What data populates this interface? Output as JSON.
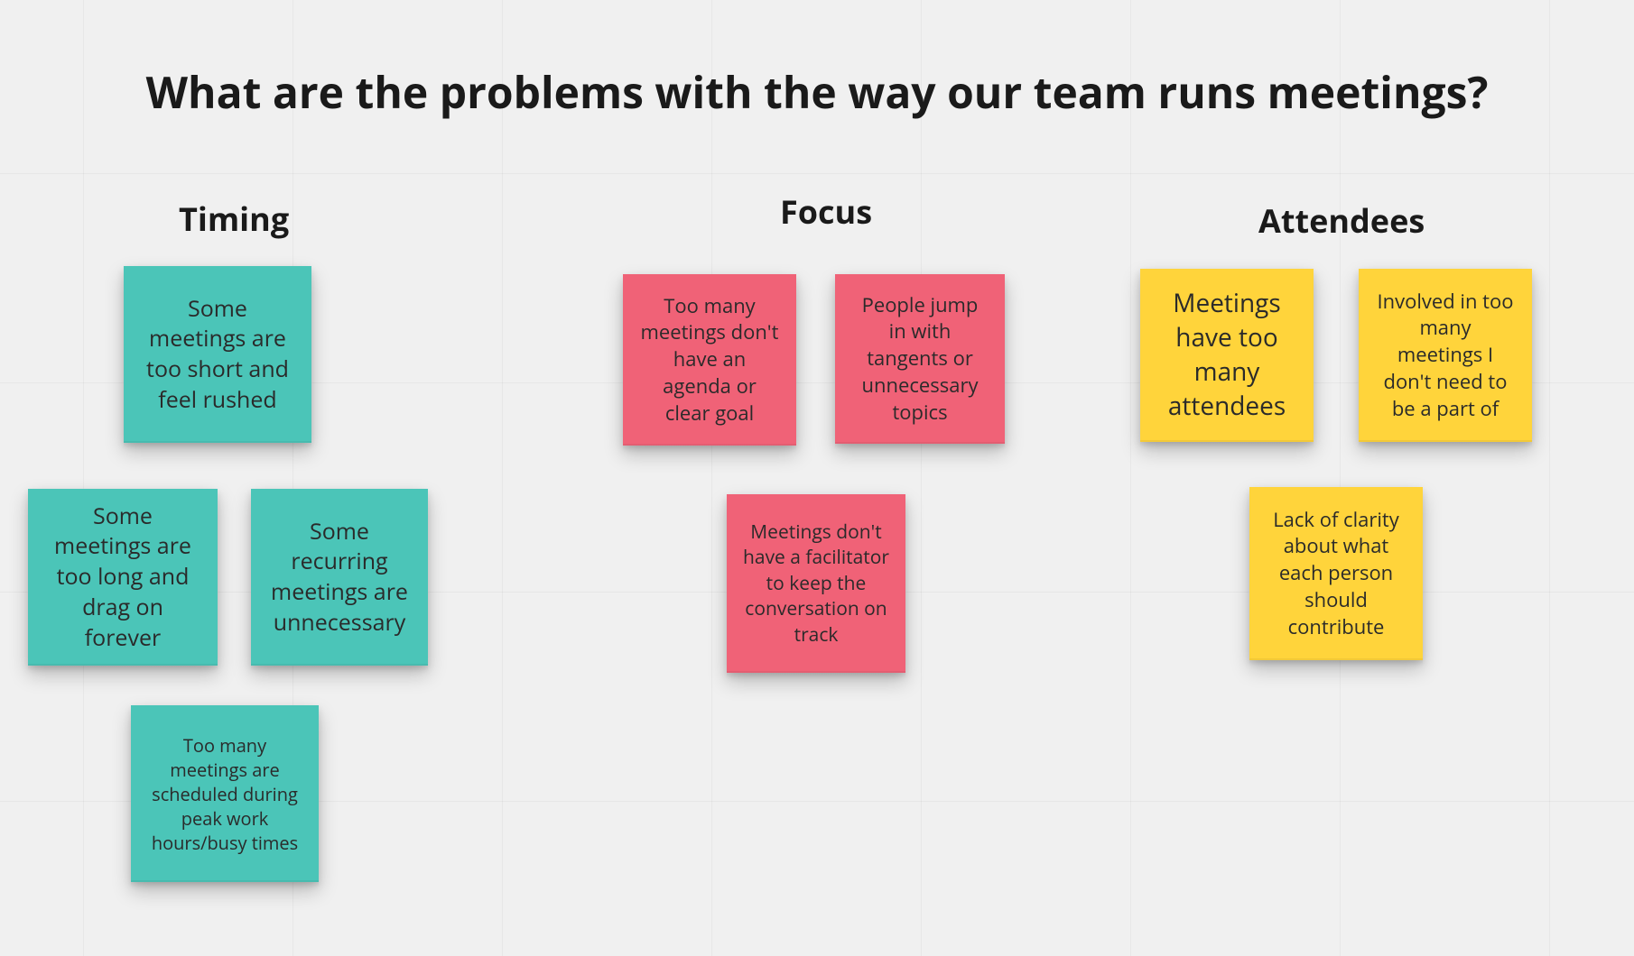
{
  "title": "What are the problems with the way our team runs meetings?",
  "groups": {
    "timing": {
      "label": "Timing"
    },
    "focus": {
      "label": "Focus"
    },
    "attendees": {
      "label": "Attendees"
    }
  },
  "stickies": {
    "timing1": "Some meetings are too short and feel rushed",
    "timing2": "Some meetings are too long and drag on forever",
    "timing3": "Some recurring meetings are unnecessary",
    "timing4": "Too many meetings are scheduled during peak work hours/busy times",
    "focus1": "Too many meetings don't have an agenda or clear goal",
    "focus2": "People jump in with tangents or unnecessary topics",
    "focus3": "Meetings don't have a facilitator to keep the conversation on track",
    "attendees1": "Meetings have too many attendees",
    "attendees2": "Involved in too many meetings I don't need to be a part of",
    "attendees3": "Lack of clarity about what each person should contribute"
  },
  "colors": {
    "teal": "#4bc5b8",
    "pink": "#f06277",
    "yellow": "#ffd43b"
  }
}
